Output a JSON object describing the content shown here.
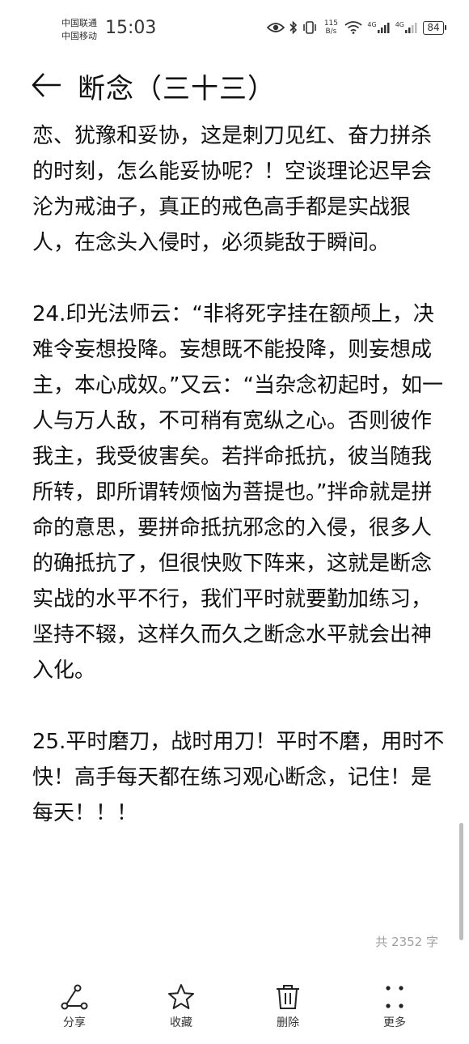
{
  "status_bar": {
    "carrier_1": "中国联通",
    "carrier_2": "中国移动",
    "time": "15:03",
    "net_speed_value": "115",
    "net_speed_unit": "B/s",
    "signal_1_label": "4G",
    "signal_2_label": "4G",
    "battery": "84",
    "icons": [
      "eye-icon",
      "bluetooth-icon",
      "vibrate-icon",
      "wifi-icon",
      "signal-icon",
      "battery-icon"
    ]
  },
  "header": {
    "title": "断念（三十三）",
    "back_icon": "back-arrow-icon"
  },
  "article": {
    "paragraphs": [
      "恋、犹豫和妥协，这是刺刀见红、奋力拼杀的时刻，怎么能妥协呢？！空谈理论迟早会沦为戒油子，真正的戒色高手都是实战狠人，在念头入侵时，必须毙敌于瞬间。",
      "24.印光法师云：“非将死字挂在额颅上，决难令妄想投降。妄想既不能投降，则妄想成主，本心成奴。”又云：“当杂念初起时，如一人与万人敌，不可稍有宽纵之心。否则彼作我主，我受彼害矣。若拌命抵抗，彼当随我所转，即所谓转烦恼为菩提也。”拌命就是拼命的意思，要拼命抵抗邪念的入侵，很多人的确抵抗了，但很快败下阵来，这就是断念实战的水平不行，我们平时就要勤加练习，坚持不辍，这样久而久之断念水平就会出神入化。",
      "25.平时磨刀，战时用刀！平时不磨，用时不快！高手每天都在练习观心断念，记住！是每天！！！"
    ]
  },
  "word_count": "共 2352 字",
  "toolbar": {
    "share_label": "分享",
    "favorite_label": "收藏",
    "delete_label": "删除",
    "more_label": "更多"
  }
}
